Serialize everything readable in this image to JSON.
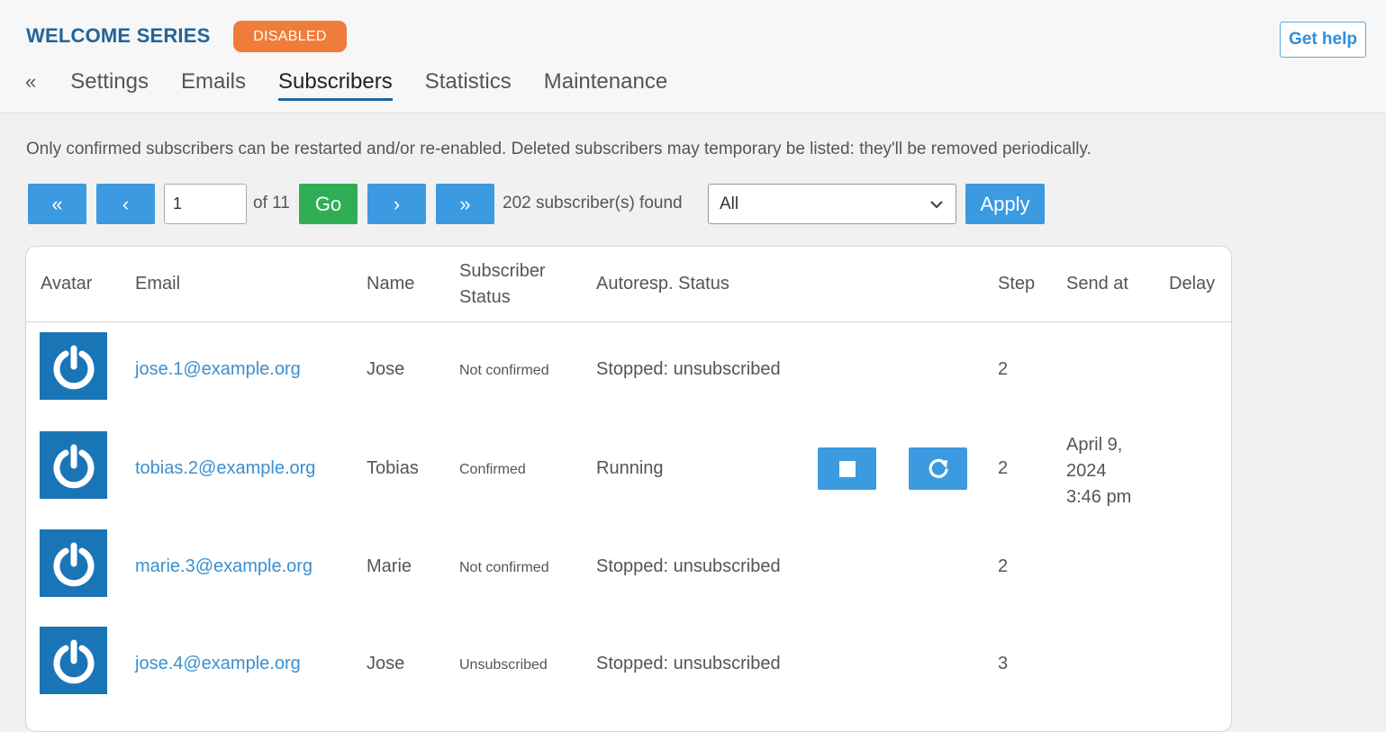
{
  "header": {
    "title": "WELCOME SERIES",
    "status_badge": "DISABLED",
    "help_label": "Get help"
  },
  "tabs": {
    "back": "«",
    "items": [
      {
        "label": "Settings"
      },
      {
        "label": "Emails"
      },
      {
        "label": "Subscribers",
        "active": true
      },
      {
        "label": "Statistics"
      },
      {
        "label": "Maintenance"
      }
    ]
  },
  "info_text": "Only confirmed subscribers can be restarted and/or re-enabled. Deleted subscribers may temporary be listed: they'll be removed periodically.",
  "pager": {
    "first": "«",
    "prev": "‹",
    "page_value": "1",
    "of_text": "of 11",
    "go": "Go",
    "next": "›",
    "last": "»",
    "found_text": "202 subscriber(s) found",
    "filter_value": "All",
    "apply": "Apply"
  },
  "table": {
    "headers": {
      "avatar": "Avatar",
      "email": "Email",
      "name": "Name",
      "subscriber_status_1": "Subscriber",
      "subscriber_status_2": "Status",
      "autoresp_status": "Autoresp. Status",
      "step": "Step",
      "send_at": "Send at",
      "delay": "Delay"
    },
    "rows": [
      {
        "email": "jose.1@example.org",
        "name": "Jose",
        "sub_status": "Not confirmed",
        "auto_status": "Stopped: unsubscribed",
        "step": "2"
      },
      {
        "email": "tobias.2@example.org",
        "name": "Tobias",
        "sub_status": "Confirmed",
        "auto_status": "Running",
        "step": "2",
        "send_at_1": "April 9,",
        "send_at_2": "2024",
        "send_at_3": "3:46 pm"
      },
      {
        "email": "marie.3@example.org",
        "name": "Marie",
        "sub_status": "Not confirmed",
        "auto_status": "Stopped: unsubscribed",
        "step": "2"
      },
      {
        "email": "jose.4@example.org",
        "name": "Jose",
        "sub_status": "Unsubscribed",
        "auto_status": "Stopped: unsubscribed",
        "step": "3"
      }
    ]
  },
  "colors": {
    "brand_blue": "#21649a",
    "button_blue": "#3b9ae0",
    "go_green": "#2fae55",
    "badge_orange": "#f07c3a",
    "avatar_blue": "#1a75b7"
  }
}
